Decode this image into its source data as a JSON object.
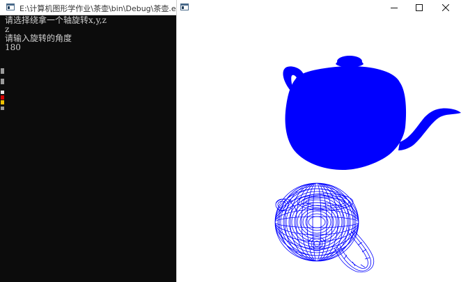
{
  "console_window": {
    "title": "E:\\计算机图形学作业\\茶壶\\bin\\Debug\\茶壶.exe",
    "lines": [
      "请选择绕拿一个轴旋转x,y,z",
      "z",
      "请输入旋转的角度",
      "180"
    ]
  },
  "graphics_window": {
    "title": "",
    "controls": {
      "minimize": "minimize-icon",
      "maximize": "maximize-icon",
      "close": "close-icon"
    },
    "render_color": "#0000ff",
    "objects": [
      {
        "name": "solid-teapot",
        "style": "filled"
      },
      {
        "name": "wireframe-teapot",
        "style": "wireframe",
        "rotation_axis": "z",
        "rotation_degrees": 180
      }
    ]
  },
  "colors": {
    "console_bg": "#0c0c0c",
    "console_text": "#d0d0d0",
    "teapot_blue": "#0000ff"
  }
}
